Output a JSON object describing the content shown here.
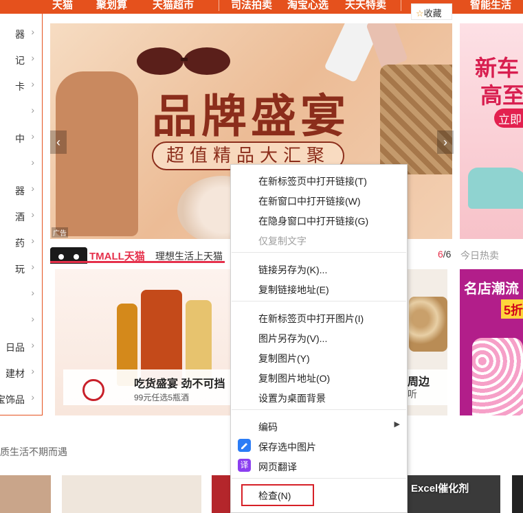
{
  "top_nav": {
    "items": [
      "天猫",
      "聚划算",
      "天猫超市",
      "司法拍卖",
      "淘宝心选",
      "天天特卖",
      "智能生活"
    ],
    "favorite_label": "收藏",
    "favorite_icon": "star-icon",
    "accent_color": "#e5511d"
  },
  "category_sidebar": {
    "items": [
      "器",
      "记",
      "卡",
      "",
      "中",
      "",
      "器",
      "酒",
      "药",
      "玩",
      "",
      "",
      "日品",
      "建材",
      "宝饰品"
    ]
  },
  "banner": {
    "headline": "品牌盛宴",
    "subheadline": "超值精品大汇聚",
    "ad_label": "广告"
  },
  "side_banner": {
    "line1": "新车",
    "line2": "高至",
    "button": "立即"
  },
  "tmall_bar": {
    "brand": "TMALL天猫",
    "slogan": "理想生活上天猫",
    "page_current": "6",
    "page_total": "/6",
    "hot_label": "今日热卖"
  },
  "product_card": {
    "headline": "吃货盛宴 劲不可挡",
    "subline": "99元任选5瓶酒"
  },
  "product_card_2": {
    "headline": "周边",
    "subline": "听"
  },
  "product_card_3": {
    "headline": "名店潮流",
    "badge": "5折"
  },
  "section": {
    "label": "质生活不期而遇"
  },
  "watermark": "Excel催化剂",
  "context_menu": {
    "group1": [
      {
        "label": "在新标签页中打开链接(T)",
        "enabled": true
      },
      {
        "label": "在新窗口中打开链接(W)",
        "enabled": true
      },
      {
        "label": "在隐身窗口中打开链接(G)",
        "enabled": true
      },
      {
        "label": "仅复制文字",
        "enabled": false
      }
    ],
    "group2": [
      {
        "label": "链接另存为(K)..."
      },
      {
        "label": "复制链接地址(E)"
      }
    ],
    "group3": [
      {
        "label": "在新标签页中打开图片(I)"
      },
      {
        "label": "图片另存为(V)..."
      },
      {
        "label": "复制图片(Y)"
      },
      {
        "label": "复制图片地址(O)"
      },
      {
        "label": "设置为桌面背景"
      }
    ],
    "group4": [
      {
        "label": "编码",
        "has_submenu": true
      },
      {
        "label": "保存选中图片",
        "icon": "save-image-icon",
        "icon_color": "#2b7cf6"
      },
      {
        "label": "网页翻译",
        "icon": "translate-icon",
        "icon_glyph": "译",
        "icon_color": "#8b3ff0"
      }
    ],
    "inspect": {
      "label": "检查(N)",
      "highlight_color": "#d61f26"
    }
  }
}
